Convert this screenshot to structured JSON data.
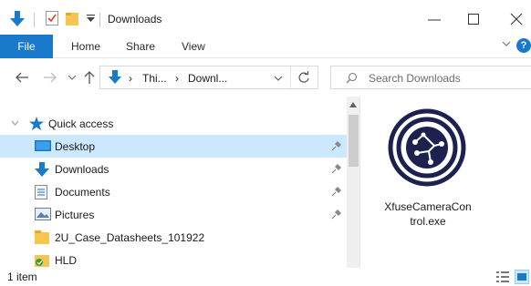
{
  "window": {
    "title": "Downloads",
    "minimize_label": "—",
    "maximize_label": "☐",
    "close_label": "✕"
  },
  "ribbon": {
    "tabs": [
      "File",
      "Home",
      "Share",
      "View"
    ],
    "help_label": "?"
  },
  "address": {
    "crumbs": [
      "Thi...",
      "Downl..."
    ]
  },
  "search": {
    "placeholder": "Search Downloads"
  },
  "nav_pane": {
    "quick_access_label": "Quick access",
    "items": [
      {
        "label": "Desktop",
        "icon": "desktop-icon",
        "pinned": true,
        "selected": true
      },
      {
        "label": "Downloads",
        "icon": "downloads-icon",
        "pinned": true,
        "selected": false
      },
      {
        "label": "Documents",
        "icon": "documents-icon",
        "pinned": true,
        "selected": false
      },
      {
        "label": "Pictures",
        "icon": "pictures-icon",
        "pinned": true,
        "selected": false
      },
      {
        "label": "2U_Case_Datasheets_101922",
        "icon": "folder-icon",
        "pinned": false,
        "selected": false
      },
      {
        "label": "HLD",
        "icon": "hld-folder-icon",
        "pinned": false,
        "selected": false
      }
    ]
  },
  "files": [
    {
      "name_line1": "XfuseCameraCon",
      "name_line2": "trol.exe",
      "icon": "xfuse-app-icon"
    }
  ],
  "status": {
    "item_count": "1 item"
  },
  "colors": {
    "accent": "#1979ca",
    "selection": "#cce8ff"
  }
}
